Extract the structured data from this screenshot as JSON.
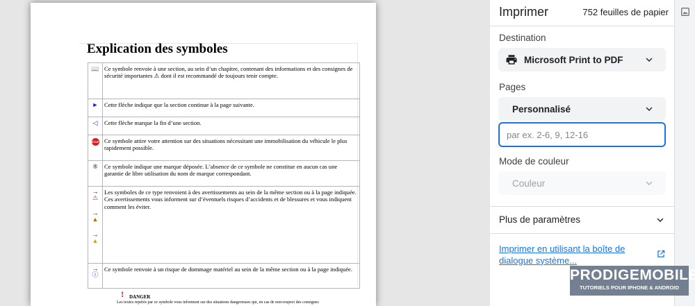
{
  "document": {
    "title": "Explication des symboles",
    "rows": [
      {
        "icon": "📖",
        "icon_name": "book-icon",
        "text": "Ce symbole renvoie à une section, au sein d’un chapitre, contenant des informations et des consignes de sécurité importantes ⚠ dont il est recommandé de toujours tenir compte."
      },
      {
        "icon": "►",
        "icon_name": "arrow-right-icon",
        "text": "Cette flèche indique que la section continue à la page suivante."
      },
      {
        "icon": "◁",
        "icon_name": "arrow-left-outline-icon",
        "text": "Cette flèche marque la fin d’une section."
      },
      {
        "icon": "STOP",
        "icon_name": "stop-icon",
        "text": "Ce symbole attire votre attention sur des situations nécessitant une immobilisation du véhicule le plus rapidement possible."
      },
      {
        "icon": "®",
        "icon_name": "registered-icon",
        "text": "Ce symbole indique une marque déposée. L’absence de ce symbole ne constitue en aucun cas une garantie de libre utilisation du nom de marque correspondant."
      },
      {
        "icon": "→",
        "icon_name": "warning-arrows-icon",
        "text": "Les symboles de ce type renvoient à des avertissements au sein de la même section ou à la page indiquée. Ces avertissements vous informent sur d’éventuels risques d’accidents et de blessures et vous indiquent comment les éviter."
      },
      {
        "icon": "→",
        "icon_name": "damage-arrow-icon",
        "text": "Ce symbole renvoie à un risque de dommage matériel au sein de la même section ou à la page indiquée."
      }
    ],
    "danger_label": "DANGER",
    "danger_text": "Les textes repérés par ce symbole vous informent sur des situations dangereuses qui, en cas de non-respect des consignes"
  },
  "panel": {
    "title": "Imprimer",
    "sheet_count": "752 feuilles de papier",
    "destination_label": "Destination",
    "destination_value": "Microsoft Print to PDF",
    "pages_label": "Pages",
    "pages_value": "Personnalisé",
    "pages_placeholder": "par ex. 2-6, 9, 12-16",
    "color_label": "Mode de couleur",
    "color_value": "Couleur",
    "more_settings": "Plus de paramètres",
    "system_dialog_link": "Imprimer en utilisant la boîte de dialogue système..."
  },
  "watermark": {
    "logo": "PRODIGEMOBILE",
    "tagline": "TUTORIELS POUR IPHONE & ANDROID"
  },
  "colors": {
    "accent": "#1a73e8",
    "panel_bg": "#ffffff",
    "dropdown_bg": "#f1f3f4",
    "warning_red": "#d01010"
  }
}
